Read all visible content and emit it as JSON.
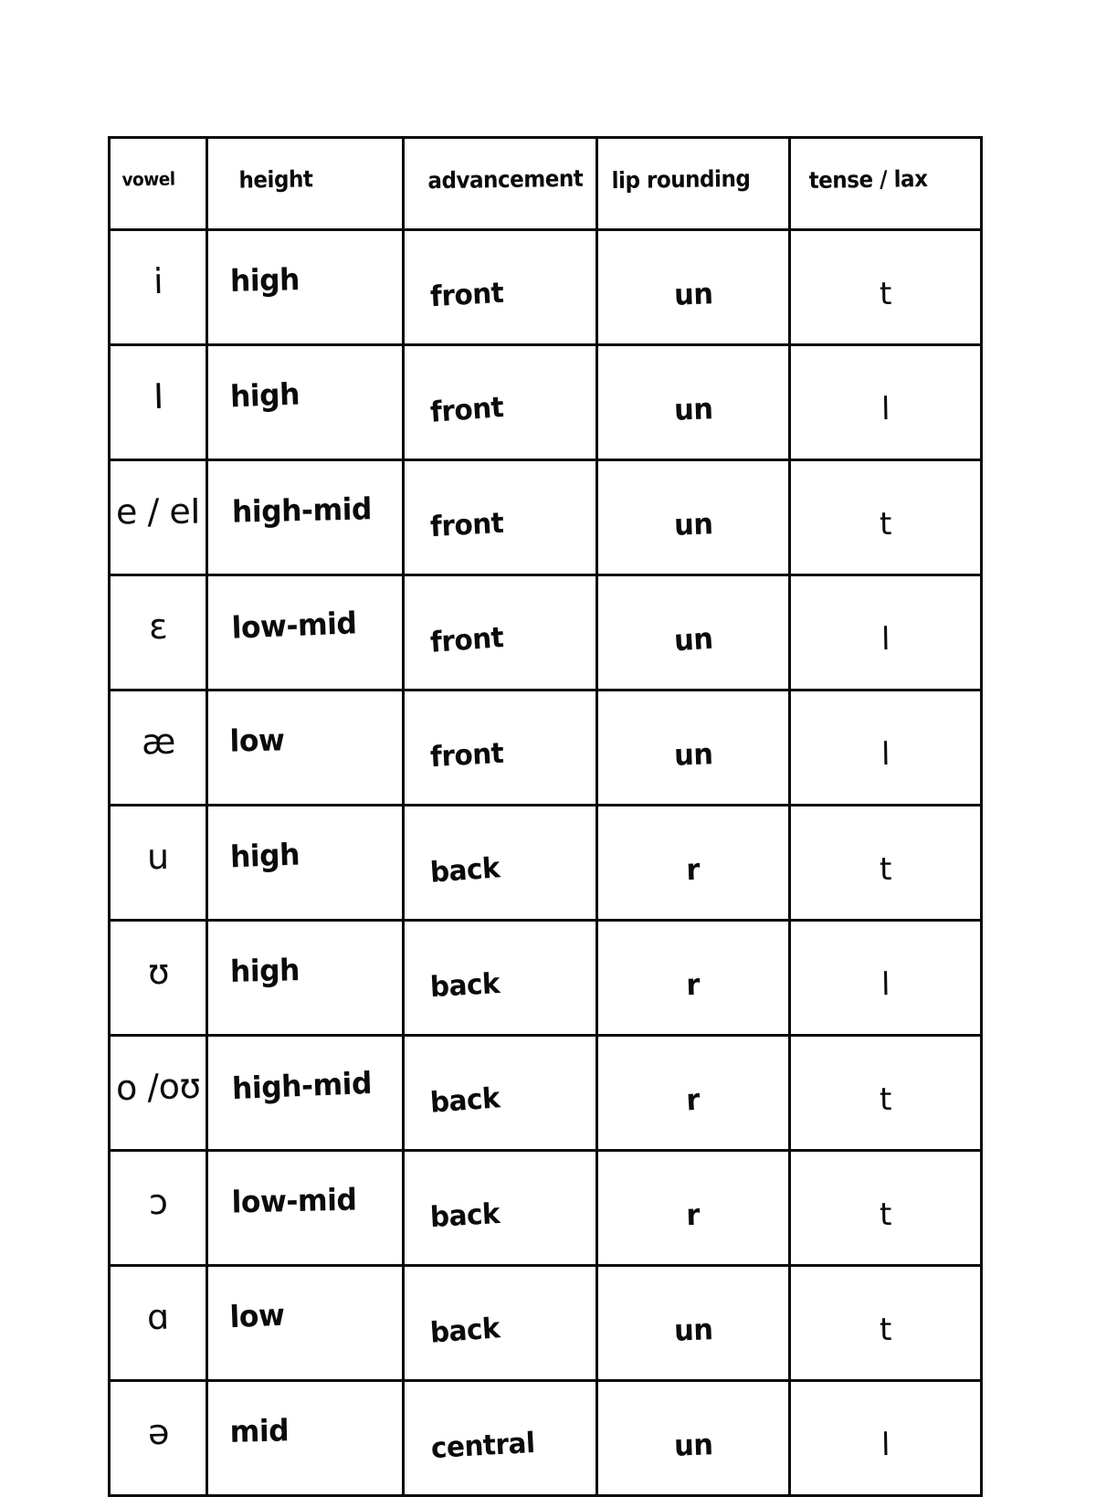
{
  "document": {
    "kind": "handwritten-table",
    "page_background": "#ffffff",
    "ink_color": "#0b0b0b"
  },
  "table": {
    "headers": [
      "vowel",
      "height",
      "advancement",
      "lip rounding",
      "tense / lax"
    ],
    "rows": [
      {
        "vowel": "i",
        "height": "high",
        "advancement": "front",
        "lip_rounding": "un",
        "tense_lax": "t"
      },
      {
        "vowel": "I",
        "height": "high",
        "advancement": "front",
        "lip_rounding": "un",
        "tense_lax": "l"
      },
      {
        "vowel": "e / eI",
        "height": "high-mid",
        "advancement": "front",
        "lip_rounding": "un",
        "tense_lax": "t"
      },
      {
        "vowel": "ɛ",
        "height": "low-mid",
        "advancement": "front",
        "lip_rounding": "un",
        "tense_lax": "l"
      },
      {
        "vowel": "æ",
        "height": "low",
        "advancement": "front",
        "lip_rounding": "un",
        "tense_lax": "l"
      },
      {
        "vowel": "u",
        "height": "high",
        "advancement": "back",
        "lip_rounding": "r",
        "tense_lax": "t"
      },
      {
        "vowel": "ʊ",
        "height": "high",
        "advancement": "back",
        "lip_rounding": "r",
        "tense_lax": "l"
      },
      {
        "vowel": "o /oʊ",
        "height": "high-mid",
        "advancement": "back",
        "lip_rounding": "r",
        "tense_lax": "t"
      },
      {
        "vowel": "ɔ",
        "height": "low-mid",
        "advancement": "back",
        "lip_rounding": "r",
        "tense_lax": "t"
      },
      {
        "vowel": "ɑ",
        "height": "low",
        "advancement": "back",
        "lip_rounding": "un",
        "tense_lax": "t"
      },
      {
        "vowel": "ə",
        "height": "mid",
        "advancement": "central",
        "lip_rounding": "un",
        "tense_lax": "l"
      }
    ]
  }
}
